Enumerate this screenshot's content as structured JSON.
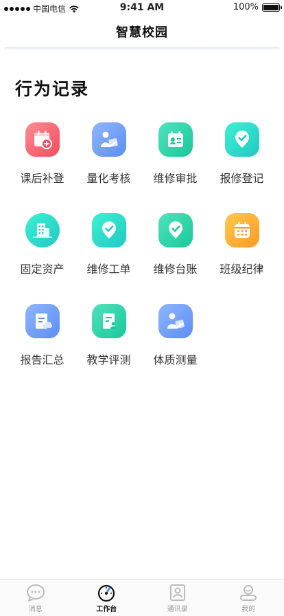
{
  "status_bar": {
    "carrier": "中国电信",
    "time": "9:41 AM",
    "battery": "100%",
    "battery_level": 1.0
  },
  "nav": {
    "title": "智慧校园"
  },
  "section": {
    "title": "行为记录"
  },
  "items": [
    {
      "label": "课后补登",
      "icon": "calendar-plus-icon",
      "color": "#f24d5d"
    },
    {
      "label": "量化考核",
      "icon": "person-document-icon",
      "color": "#5c8df2"
    },
    {
      "label": "维修审批",
      "icon": "id-card-icon",
      "color": "#19c99a"
    },
    {
      "label": "报修登记",
      "icon": "check-location-icon",
      "color": "#1fc9c4"
    },
    {
      "label": "固定资产",
      "icon": "building-icon",
      "color": "#1fc9c4"
    },
    {
      "label": "维修工单",
      "icon": "check-location-icon",
      "color": "#1fc9c4"
    },
    {
      "label": "维修台账",
      "icon": "check-location-icon",
      "color": "#19c99a"
    },
    {
      "label": "班级纪律",
      "icon": "calendar-icon",
      "color": "#ff9a1f"
    },
    {
      "label": "报告汇总",
      "icon": "document-cloud-icon",
      "color": "#5c8df2"
    },
    {
      "label": "教学评测",
      "icon": "document-person-icon",
      "color": "#19c99a"
    },
    {
      "label": "体质测量",
      "icon": "person-document-icon",
      "color": "#5c8df2"
    }
  ],
  "tabs": [
    {
      "label": "消息",
      "icon": "message-icon",
      "active": false
    },
    {
      "label": "工作台",
      "icon": "dashboard-icon",
      "active": true
    },
    {
      "label": "通讯录",
      "icon": "contacts-icon",
      "active": false
    },
    {
      "label": "我的",
      "icon": "profile-icon",
      "active": false
    }
  ]
}
